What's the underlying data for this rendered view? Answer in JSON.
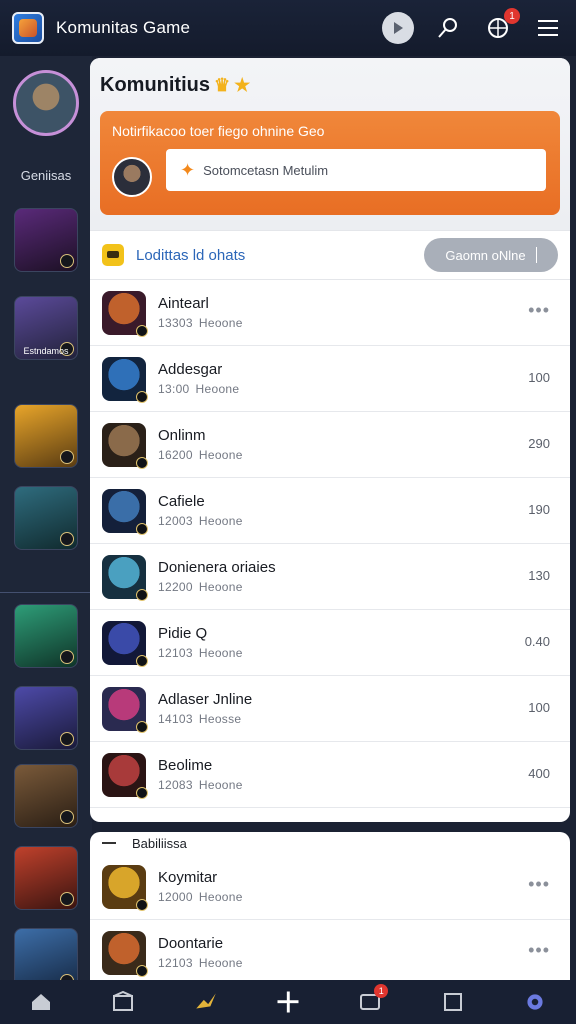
{
  "app": {
    "title": "Komunitas Game"
  },
  "topbar": {
    "notification_badge": "1"
  },
  "rail": {
    "label": "Geniisas",
    "games": [
      {
        "caption": "",
        "colors": [
          "#5a2a7a",
          "#1c1024"
        ]
      },
      {
        "caption": "Estndamos",
        "colors": [
          "#5b4a9a",
          "#22223a"
        ]
      },
      {
        "caption": "",
        "colors": [
          "#e8a52a",
          "#5a3c12"
        ]
      },
      {
        "caption": "",
        "colors": [
          "#2f6c7e",
          "#102a2e"
        ]
      },
      {
        "caption": "",
        "colors": [
          "#2e9d78",
          "#0f3428"
        ]
      },
      {
        "caption": "",
        "colors": [
          "#4d4aa8",
          "#1a1a3a"
        ]
      },
      {
        "caption": "",
        "colors": [
          "#7a5a3a",
          "#2a1e14"
        ]
      },
      {
        "caption": "",
        "colors": [
          "#c0412c",
          "#3a1410"
        ]
      },
      {
        "caption": "",
        "colors": [
          "#3d6ea8",
          "#142640"
        ]
      }
    ]
  },
  "panel": {
    "title": "Komunitius",
    "notification": {
      "title": "Notirfikacoo toer fiego ohnine Geo",
      "input_text": "Sotomcetasn Metulim"
    },
    "chats": {
      "title": "Lodittas ld ohats",
      "online_button": "Gaomn oNlne",
      "items": [
        {
          "name": "Aintearl",
          "time": "13303",
          "status": "Heoone",
          "meta": "•••",
          "colors": [
            "#c0612c",
            "#3a1a2a"
          ]
        },
        {
          "name": "Addesgar",
          "time": "13:00",
          "status": "Heoone",
          "meta": "100",
          "colors": [
            "#2f70b8",
            "#12243e"
          ]
        },
        {
          "name": "Onlinm",
          "time": "16200",
          "status": "Heoone",
          "meta": "290",
          "colors": [
            "#8a6a4a",
            "#2a2018"
          ]
        },
        {
          "name": "Cafiele",
          "time": "12003",
          "status": "Heoone",
          "meta": "190",
          "colors": [
            "#3a6ea8",
            "#14203a"
          ]
        },
        {
          "name": "Donienera oriaies",
          "time": "12200",
          "status": "Heoone",
          "meta": "130",
          "colors": [
            "#4aa0c0",
            "#163040"
          ]
        },
        {
          "name": "Pidie Q",
          "time": "12103",
          "status": "Heoone",
          "meta": "0.40",
          "colors": [
            "#3a4aa8",
            "#121838"
          ]
        },
        {
          "name": "Adlaser Jnline",
          "time": "14103",
          "status": "Heosse",
          "meta": "100",
          "colors": [
            "#b83a7a",
            "#2a2a50"
          ]
        },
        {
          "name": "Beolime",
          "time": "12083",
          "status": "Heoone",
          "meta": "400",
          "colors": [
            "#a83a3a",
            "#2a1414"
          ]
        }
      ]
    }
  },
  "panel2": {
    "section_label": "Babiliissa",
    "items": [
      {
        "name": "Koymitar",
        "time": "12000",
        "status": "Heoone",
        "meta": "•••",
        "colors": [
          "#d8a52a",
          "#5a3c12"
        ]
      },
      {
        "name": "Doontarie",
        "time": "12103",
        "status": "Heoone",
        "meta": "•••",
        "colors": [
          "#c0612c",
          "#3a2a1a"
        ]
      }
    ]
  },
  "bottomnav": {
    "badge": "1"
  }
}
